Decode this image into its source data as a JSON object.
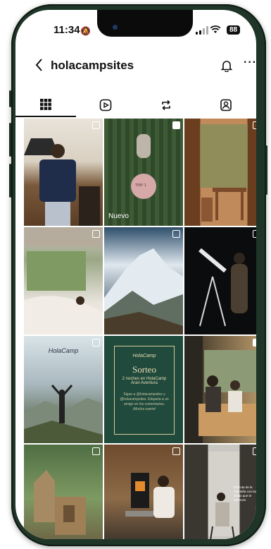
{
  "status_bar": {
    "time": "11:34",
    "battery": "88"
  },
  "header": {
    "username": "holacampsites"
  },
  "tabs": [
    {
      "name": "posts-grid",
      "icon": "grid-icon",
      "active": true
    },
    {
      "name": "reels",
      "icon": "reels-icon",
      "active": false
    },
    {
      "name": "reposts",
      "icon": "repost-icon",
      "active": false
    },
    {
      "name": "tagged",
      "icon": "tagged-icon",
      "active": false
    }
  ],
  "posts": {
    "p2_label": "Nuevo",
    "p2_sign": "TINY 1",
    "p7_brand": "HolaCamp",
    "p8_brand": "HolaCamp",
    "p8_title": "Sorteo",
    "p8_subtitle": "2 noches en HolaCamp Aran Aventura",
    "p8_body": "Sigue a @holacampsites y @holacampsites. Etiqueta a un amigo en los comentarios. ¡Mucha suerte!",
    "p12_caption": "Disfruta de la montaña con las vistas que te mereces"
  },
  "colors": {
    "phone_frame": "#1f3528",
    "active_tab_underline": "#111111",
    "sorteo_background": "#1f4a3c"
  }
}
